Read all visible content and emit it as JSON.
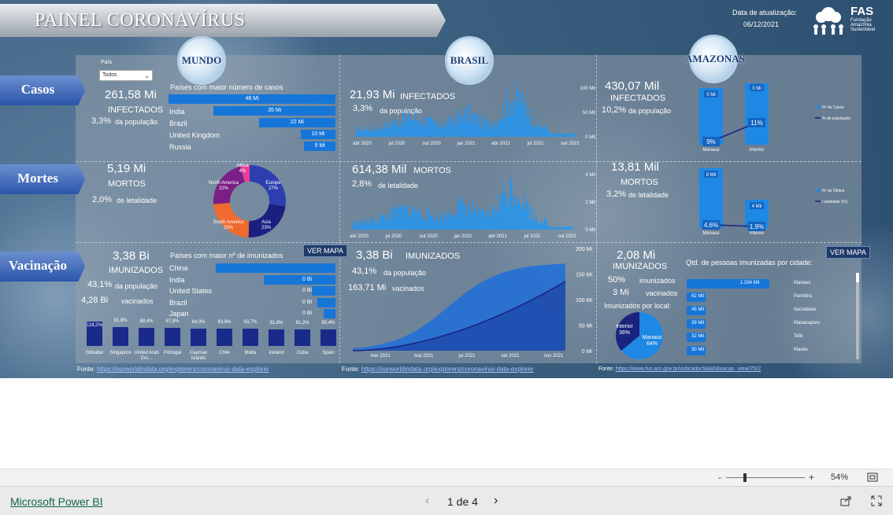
{
  "header": {
    "title": "PAINEL CORONAVÍRUS",
    "update_label": "Data de atualização:",
    "update_date": "06/12/2021",
    "logo_text": "FAS",
    "logo_sub": [
      "Fundação",
      "Amazônia",
      "Sustentável"
    ]
  },
  "rows": {
    "casos": "Casos",
    "mortes": "Mortes",
    "vacinacao": "Vacinação"
  },
  "globes": {
    "mundo": "MUNDO",
    "brasil": "BRASIL",
    "amazonas": "AMAZONAS"
  },
  "filter": {
    "label": "País",
    "value": "Todos"
  },
  "mundo": {
    "casos": {
      "value": "261,58 Mi",
      "label": "INFECTADOS",
      "pct": "3,3%",
      "pct_label": "da população"
    },
    "top_casos_title": "Países com maior número de casos",
    "top_casos": [
      {
        "name": "United States",
        "value": 48,
        "label": "48 Mi"
      },
      {
        "name": "India",
        "value": 35,
        "label": "35 Mi"
      },
      {
        "name": "Brazil",
        "value": 22,
        "label": "22 Mi"
      },
      {
        "name": "United Kingdom",
        "value": 10,
        "label": "10 Mi"
      },
      {
        "name": "Russia",
        "value": 9,
        "label": "9 Mi"
      }
    ],
    "mortes": {
      "value": "5,19 Mi",
      "label": "MORTOS",
      "pct": "2,0%",
      "pct_label": "de letalidade"
    },
    "donut": [
      {
        "name": "Europe",
        "pct": 27,
        "label": "27%",
        "color": "#2d3fb0"
      },
      {
        "name": "Asia",
        "pct": 23,
        "label": "23%",
        "color": "#1b1f80"
      },
      {
        "name": "South America",
        "pct": 23,
        "label": "23%",
        "color": "#ef6a2e"
      },
      {
        "name": "North America",
        "pct": 22,
        "label": "22%",
        "color": "#7b1e86"
      },
      {
        "name": "Africa",
        "pct": 4,
        "label": "4%",
        "color": "#e83e9b"
      }
    ],
    "vac": {
      "value": "3,38 Bi",
      "label": "IMUNIZADOS",
      "pct": "43,1%",
      "pct_label": "da população",
      "vacc_value": "4,28 Bi",
      "vacc_label": "vacinados"
    },
    "top_vac_title": "Países com maior nº de imunizados",
    "top_vac": [
      {
        "name": "China",
        "value": 1,
        "label": ""
      },
      {
        "name": "India",
        "value": 0.6,
        "label": "0 Bi"
      },
      {
        "name": "United States",
        "value": 0.2,
        "label": "0 Bi"
      },
      {
        "name": "Brazil",
        "value": 0.15,
        "label": "0 Bi"
      },
      {
        "name": "Japan",
        "value": 0.1,
        "label": "0 Bi"
      }
    ],
    "ver_mapa": "VER MAPA",
    "pct_countries": [
      {
        "name": "Gibraltar",
        "value": 118.2,
        "label": "118,2%"
      },
      {
        "name": "Singapore",
        "value": 91.9,
        "label": "91,9%"
      },
      {
        "name": "United Arab Em...",
        "value": 88.4,
        "label": "88,4%"
      },
      {
        "name": "Portugal",
        "value": 87.8,
        "label": "87,8%"
      },
      {
        "name": "Cayman Islands",
        "value": 84.0,
        "label": "84,0%"
      },
      {
        "name": "Chile",
        "value": 83.9,
        "label": "83,9%"
      },
      {
        "name": "Malta",
        "value": 83.7,
        "label": "83,7%"
      },
      {
        "name": "Iceland",
        "value": 81.8,
        "label": "81,8%"
      },
      {
        "name": "Cuba",
        "value": 81.2,
        "label": "81,2%"
      },
      {
        "name": "Spain",
        "value": 80.4,
        "label": "80,4%"
      }
    ]
  },
  "brasil": {
    "casos": {
      "value": "21,93 Mi",
      "label": "INFECTADOS",
      "pct": "3,3%",
      "pct_label": "da população"
    },
    "casos_axis_y": [
      "100 Mil",
      "50 Mil",
      "0 Mil"
    ],
    "casos_axis_x": [
      "abr 2020",
      "jul 2020",
      "out 2020",
      "jan 2021",
      "abr 2021",
      "jul 2021",
      "out 2021"
    ],
    "mortes": {
      "value": "614,38 Mil",
      "label": "MORTOS",
      "pct": "2,8%",
      "pct_label": "de letalidade"
    },
    "mortes_axis_y": [
      "4 Mil",
      "2 Mil",
      "0 Mil"
    ],
    "mortes_axis_x": [
      "abr 2020",
      "jul 2020",
      "out 2020",
      "jan 2021",
      "abr 2021",
      "jul 2021",
      "out 2021"
    ],
    "vac": {
      "value": "3,38 Bi",
      "label": "IMUNIZADOS",
      "pct": "43,1%",
      "pct_label": "da população",
      "vacc_value": "163,71 Mi",
      "vacc_label": "vacinados"
    },
    "vac_axis_y": [
      "200 Mi",
      "150 Mi",
      "100 Mi",
      "50 Mi",
      "0 Mi"
    ],
    "vac_axis_x": [
      "mar 2021",
      "mai 2021",
      "jul 2021",
      "set 2021",
      "nov 2021"
    ]
  },
  "amazonas": {
    "casos": {
      "value": "430,07 Mil",
      "label": "INFECTADOS",
      "pct": "10,2%",
      "pct_label": "da população"
    },
    "casos_bars": [
      {
        "name": "Manaus",
        "bar_label": "0 Mi",
        "pct_label": "9%"
      },
      {
        "name": "Interior",
        "bar_label": "0 Mi",
        "pct_label": "11%"
      }
    ],
    "casos_legend": [
      "Nº de Casos",
      "% de população"
    ],
    "mortes": {
      "value": "13,81 Mil",
      "label": "MORTOS",
      "pct": "3,2%",
      "pct_label": "de letalidade"
    },
    "mortes_bars": [
      {
        "name": "Manaus",
        "bar_label": "9 Mil",
        "pct_label": "4,6%"
      },
      {
        "name": "Interior",
        "bar_label": "4 Mil",
        "pct_label": "1,9%"
      }
    ],
    "mortes_legend": [
      "Nº de Óbitos",
      "Letalidade (%)"
    ],
    "vac": {
      "value": "2,08 Mi",
      "label": "IMUNIZADOS",
      "pct": "50%",
      "pct_label": "imunizados",
      "vacc_value": "3 Mi",
      "vacc_label": "vacinados"
    },
    "local_title": "Imunizados por local:",
    "local_pie": [
      {
        "name": "Manaus",
        "pct": 64,
        "label": "64%",
        "color": "#1e88e5"
      },
      {
        "name": "Interior",
        "pct": 36,
        "label": "36%",
        "color": "#1a237e"
      }
    ],
    "cidades_title": "Qtd. de pessoas imunizadas por cidade:",
    "cidades": [
      {
        "name": "Manaus",
        "value": 1334,
        "label": "1.334 Mil"
      },
      {
        "name": "Parintins",
        "value": 62,
        "label": "62 Mil"
      },
      {
        "name": "Itacoatiara",
        "value": 45,
        "label": "45 Mil"
      },
      {
        "name": "Manacapuru",
        "value": 39,
        "label": "39 Mil"
      },
      {
        "name": "Tefé",
        "value": 32,
        "label": "32 Mil"
      },
      {
        "name": "Maués",
        "value": 30,
        "label": "30 Mil"
      }
    ],
    "ver_mapa": "VER MAPA"
  },
  "fontes": {
    "label": "Fonte:",
    "mundo": "https://ourworldindata.org/explorers/coronavirus-data-explorer",
    "brasil": "https://ourworldindata.org/explorers/coronavirus-data-explorer",
    "amazonas": "https://www.fvs.am.gov.br/indicadorSalaSituacao_view/75/2"
  },
  "zoom": {
    "minus": "-",
    "plus": "+",
    "level": "54%"
  },
  "footer": {
    "brand": "Microsoft Power BI",
    "page": "1 de 4",
    "prev": "‹",
    "next": "›"
  }
}
